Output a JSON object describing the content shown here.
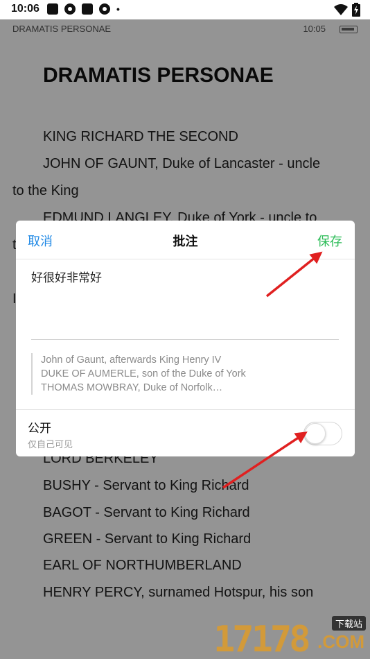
{
  "status_bar": {
    "time": "10:06",
    "dot": "•",
    "icons_left": [
      "square-notification-icon",
      "pinwheel-icon",
      "square-notification-icon",
      "pinwheel-icon"
    ],
    "icons_right": [
      "wifi-icon",
      "battery-charging-icon"
    ]
  },
  "reader": {
    "header_title": "DRAMATIS PERSONAE",
    "header_time": "10:05",
    "page_title": "DRAMATIS PERSONAE",
    "lines": [
      "KING RICHARD THE SECOND",
      "JOHN OF GAUNT, Duke of Lancaster - uncle",
      "to the King",
      "EDMUND LANGLEY, Duke of York - uncle to",
      "t",
      "I",
      "LORD BERKELEY",
      "BUSHY - Servant to King Richard",
      "BAGOT - Servant to King Richard",
      "GREEN - Servant to King Richard",
      "EARL OF NORTHUMBERLAND",
      "HENRY PERCY, surnamed Hotspur, his son"
    ]
  },
  "dialog": {
    "cancel_label": "取消",
    "title": "批注",
    "save_label": "保存",
    "note_value": "好很好非常好",
    "quote_lines": [
      "John of Gaunt, afterwards King Henry IV",
      "DUKE OF AUMERLE, son of the Duke of York",
      "THOMAS MOWBRAY, Duke of Norfolk…"
    ],
    "public_label": "公开",
    "public_sub": "仅自己可见",
    "public_on": false
  },
  "colors": {
    "cancel": "#1e88e5",
    "save": "#2ebd59",
    "arrow": "#e02020",
    "watermark": "#d29a3a"
  },
  "watermark": {
    "number": "17178",
    "tag": "下载站",
    "suffix": ".COM"
  }
}
